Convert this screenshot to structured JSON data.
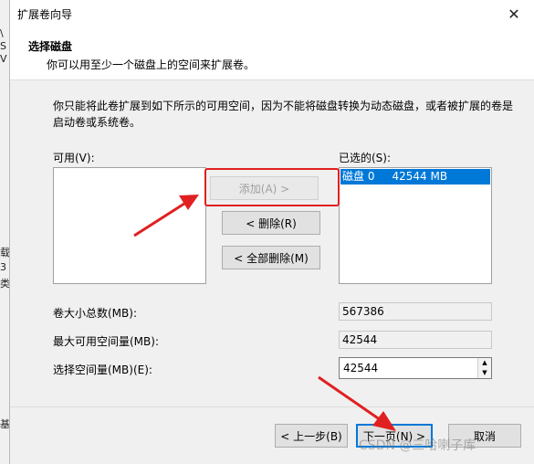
{
  "window": {
    "title": "扩展卷向导"
  },
  "header": {
    "title": "选择磁盘",
    "subtitle": "你可以用至少一个磁盘上的空间来扩展卷。"
  },
  "description": "你只能将此卷扩展到如下所示的可用空间，因为不能将磁盘转换为动态磁盘，或者被扩展的卷是启动卷或系统卷。",
  "available": {
    "label": "可用(V):"
  },
  "selected": {
    "label": "已选的(S):",
    "items": [
      "磁盘 0     42544 MB"
    ]
  },
  "buttons": {
    "add": "添加(A) >",
    "remove": "< 删除(R)",
    "remove_all": "< 全部删除(M)",
    "back": "< 上一步(B)",
    "next": "下一页(N) >",
    "cancel": "取消"
  },
  "fields": {
    "total_label": "卷大小总数(MB):",
    "total_value": "567386",
    "max_label": "最大可用空间量(MB):",
    "max_value": "42544",
    "select_label": "选择空间量(MB)(E):",
    "select_value": "42544"
  },
  "watermark": "CSDN @三哈喇子库",
  "background_glyphs": [
    "\\",
    "S",
    "V",
    "载",
    "3",
    "类",
    "基"
  ],
  "colors": {
    "selection": "#0078d7",
    "annotation": "#e02020"
  }
}
